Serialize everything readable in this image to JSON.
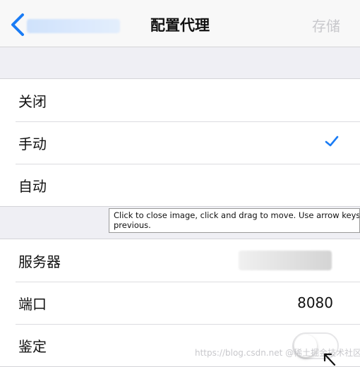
{
  "nav": {
    "title": "配置代理",
    "save_label": "存储"
  },
  "modes": [
    {
      "label": "关闭",
      "selected": false
    },
    {
      "label": "手动",
      "selected": true
    },
    {
      "label": "自动",
      "selected": false
    }
  ],
  "manual": {
    "server_label": "服务器",
    "port_label": "端口",
    "port_value": "8080",
    "auth_label": "鉴定",
    "auth_enabled": false
  },
  "tooltip": {
    "line1": "Click to close image, click and drag to move. Use arrow keys",
    "line2": "previous."
  },
  "watermark": "https://blog.csdn.net @稀土掘金技术社区",
  "colors": {
    "accent": "#1a7cf5",
    "background": "#efeff4",
    "disabled_text": "#c8c8cc"
  },
  "icons": {
    "back": "chevron-left-icon",
    "check": "checkmark-icon",
    "cursor": "mouse-pointer-icon"
  }
}
